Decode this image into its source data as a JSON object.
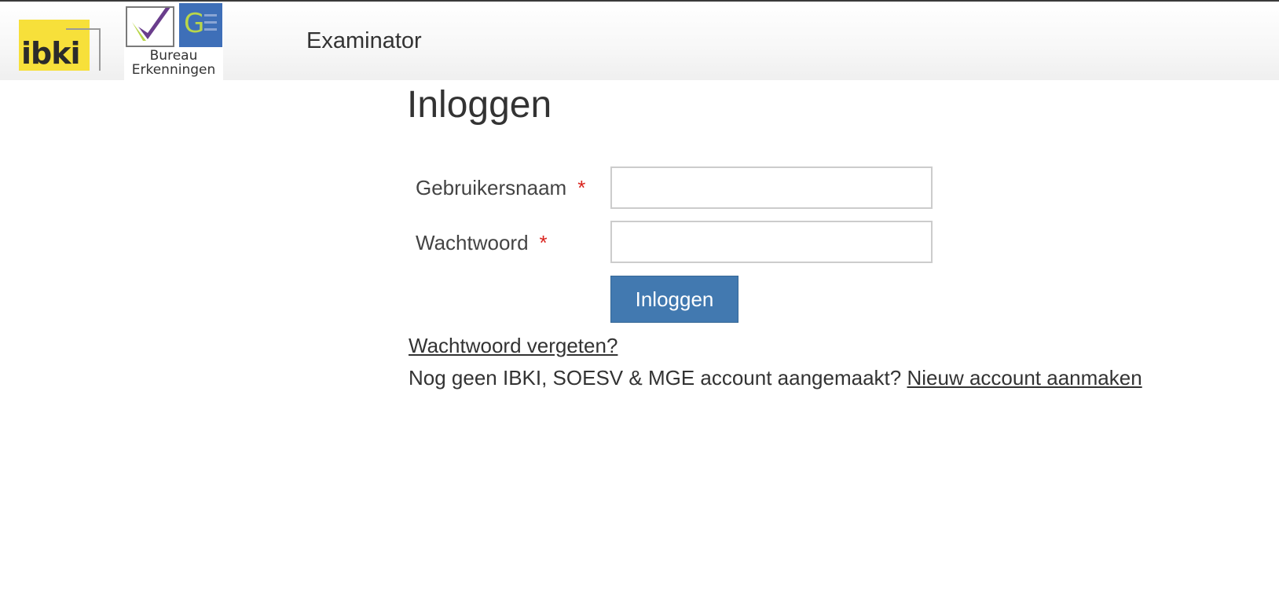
{
  "header": {
    "logo_ibki_text": "ibki",
    "logo_be_mark": "GE",
    "logo_be_caption_line1": "Bureau",
    "logo_be_caption_line2": "Erkenningen",
    "app_title": "Examinator"
  },
  "login": {
    "title": "Inloggen",
    "username_label": "Gebruikersnaam",
    "username_value": "",
    "password_label": "Wachtwoord",
    "password_value": "",
    "required_marker": "*",
    "submit_label": "Inloggen",
    "forgot_password_link": "Wachtwoord vergeten?",
    "register_prompt": "Nog geen IBKI, SOESV & MGE account aangemaakt?",
    "register_link": "Nieuw account aanmaken"
  },
  "colors": {
    "button_bg": "#4279b0",
    "required": "#d9231d",
    "ibki_yellow": "#f7e03a",
    "ge_blue": "#3e6fb8",
    "ge_green": "#b9d64a"
  },
  "icons": {
    "checkmark": "check-logo-icon"
  }
}
